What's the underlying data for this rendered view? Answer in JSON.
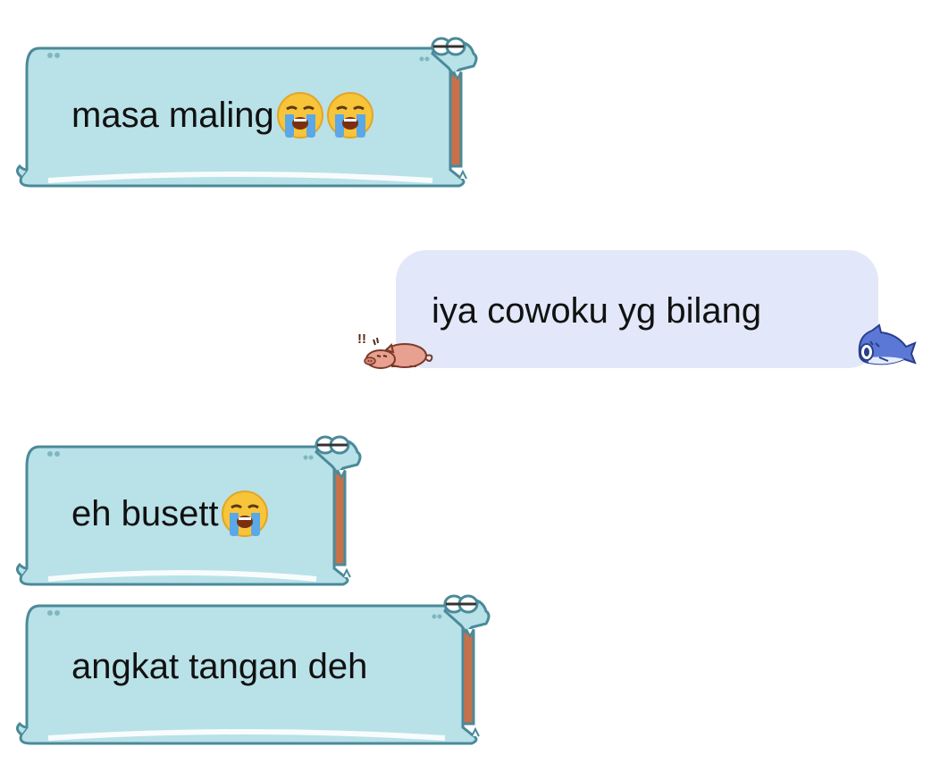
{
  "messages": [
    {
      "side": "incoming",
      "text": "masa maling",
      "emoji": [
        "loudly-crying-face",
        "loudly-crying-face"
      ],
      "theme": "crocodile-bubble"
    },
    {
      "side": "outgoing",
      "text": "iya cowoku yg bilang",
      "theme": "pig-shark-bubble"
    },
    {
      "side": "incoming",
      "text": "eh busett",
      "emoji": [
        "loudly-crying-face"
      ],
      "theme": "crocodile-bubble"
    },
    {
      "side": "incoming",
      "text": "angkat tangan deh",
      "emoji": [],
      "theme": "crocodile-bubble"
    }
  ],
  "colors": {
    "incoming_bubble": "#b9e1e8",
    "incoming_outline": "#4a8a99",
    "croc_mouth": "#c8704a",
    "outgoing_bubble": "#e2e8f9",
    "text": "#111111"
  }
}
